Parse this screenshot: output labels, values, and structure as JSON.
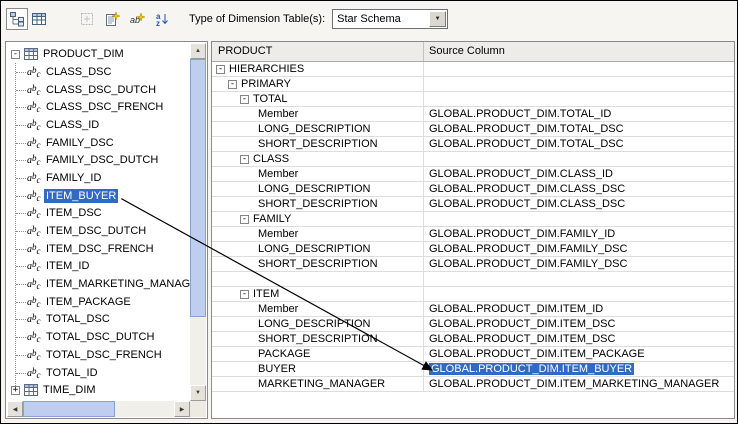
{
  "colors": {
    "selection": "#316AC5",
    "selection_text": "#FFFFFF"
  },
  "toolbar": {
    "type_label": "Type of Dimension Table(s):",
    "type_value": "Star Schema",
    "combo_arrow": "▼"
  },
  "tree": {
    "root_label": "PRODUCT_DIM",
    "root_toggle": "-",
    "sibling_label": "TIME_DIM",
    "sibling_toggle": "+",
    "items": [
      {
        "label": "CLASS_DSC",
        "selected": false
      },
      {
        "label": "CLASS_DSC_DUTCH",
        "selected": false
      },
      {
        "label": "CLASS_DSC_FRENCH",
        "selected": false
      },
      {
        "label": "CLASS_ID",
        "selected": false
      },
      {
        "label": "FAMILY_DSC",
        "selected": false
      },
      {
        "label": "FAMILY_DSC_DUTCH",
        "selected": false
      },
      {
        "label": "FAMILY_ID",
        "selected": false
      },
      {
        "label": "ITEM_BUYER",
        "selected": true
      },
      {
        "label": "ITEM_DSC",
        "selected": false
      },
      {
        "label": "ITEM_DSC_DUTCH",
        "selected": false
      },
      {
        "label": "ITEM_DSC_FRENCH",
        "selected": false
      },
      {
        "label": "ITEM_ID",
        "selected": false
      },
      {
        "label": "ITEM_MARKETING_MANAGER",
        "selected": false
      },
      {
        "label": "ITEM_PACKAGE",
        "selected": false
      },
      {
        "label": "TOTAL_DSC",
        "selected": false
      },
      {
        "label": "TOTAL_DSC_DUTCH",
        "selected": false
      },
      {
        "label": "TOTAL_DSC_FRENCH",
        "selected": false
      },
      {
        "label": "TOTAL_ID",
        "selected": false
      }
    ]
  },
  "table": {
    "columns": [
      "PRODUCT",
      "Source Column"
    ],
    "rows": [
      {
        "label": "HIERARCHIES",
        "indent": 0,
        "expandable": true,
        "source": ""
      },
      {
        "label": "PRIMARY",
        "indent": 1,
        "expandable": true,
        "source": ""
      },
      {
        "label": "TOTAL",
        "indent": 2,
        "expandable": true,
        "source": ""
      },
      {
        "label": "Member",
        "indent": 3,
        "source": "GLOBAL.PRODUCT_DIM.TOTAL_ID"
      },
      {
        "label": "LONG_DESCRIPTION",
        "indent": 3,
        "source": "GLOBAL.PRODUCT_DIM.TOTAL_DSC"
      },
      {
        "label": "SHORT_DESCRIPTION",
        "indent": 3,
        "source": "GLOBAL.PRODUCT_DIM.TOTAL_DSC"
      },
      {
        "label": "CLASS",
        "indent": 2,
        "expandable": true,
        "source": ""
      },
      {
        "label": "Member",
        "indent": 3,
        "source": "GLOBAL.PRODUCT_DIM.CLASS_ID"
      },
      {
        "label": "LONG_DESCRIPTION",
        "indent": 3,
        "source": "GLOBAL.PRODUCT_DIM.CLASS_DSC"
      },
      {
        "label": "SHORT_DESCRIPTION",
        "indent": 3,
        "source": "GLOBAL.PRODUCT_DIM.CLASS_DSC"
      },
      {
        "label": "FAMILY",
        "indent": 2,
        "expandable": true,
        "source": ""
      },
      {
        "label": "Member",
        "indent": 3,
        "source": "GLOBAL.PRODUCT_DIM.FAMILY_ID"
      },
      {
        "label": "LONG_DESCRIPTION",
        "indent": 3,
        "source": "GLOBAL.PRODUCT_DIM.FAMILY_DSC"
      },
      {
        "label": "SHORT_DESCRIPTION",
        "indent": 3,
        "source": "GLOBAL.PRODUCT_DIM.FAMILY_DSC"
      },
      {
        "blank": true
      },
      {
        "label": "ITEM",
        "indent": 2,
        "expandable": true,
        "source": ""
      },
      {
        "label": "Member",
        "indent": 3,
        "source": "GLOBAL.PRODUCT_DIM.ITEM_ID"
      },
      {
        "label": "LONG_DESCRIPTION",
        "indent": 3,
        "source": "GLOBAL.PRODUCT_DIM.ITEM_DSC"
      },
      {
        "label": "SHORT_DESCRIPTION",
        "indent": 3,
        "source": "GLOBAL.PRODUCT_DIM.ITEM_DSC"
      },
      {
        "label": "PACKAGE",
        "indent": 3,
        "source": "GLOBAL.PRODUCT_DIM.ITEM_PACKAGE"
      },
      {
        "label": "BUYER",
        "indent": 3,
        "source": "GLOBAL.PRODUCT_DIM.ITEM_BUYER",
        "highlighted": true
      },
      {
        "label": "MARKETING_MANAGER",
        "indent": 3,
        "source": "GLOBAL.PRODUCT_DIM.ITEM_MARKETING_MANAGER"
      }
    ]
  }
}
